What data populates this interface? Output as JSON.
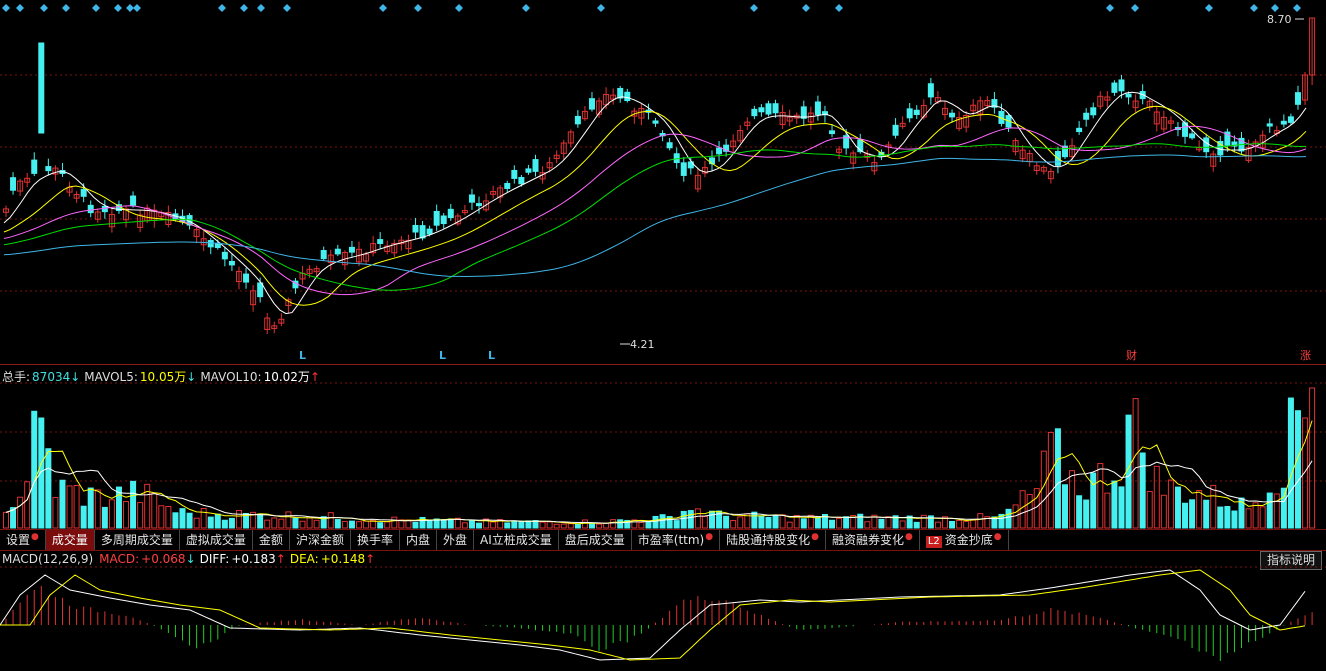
{
  "price_panel": {
    "high_label": "8.70",
    "low_label": "4.21",
    "signal_label": "L",
    "news_label": "财",
    "limit_label": "涨",
    "colors": {
      "up": "#e03232",
      "down": "#47f0f0",
      "ma5": "#ffffff",
      "ma10": "#ffff00",
      "ma20": "#ff66ff",
      "ma30": "#00dd00",
      "ma60": "#3fb6e8",
      "grid": "#7a1414",
      "marker": "#3fb6e8"
    }
  },
  "volume_panel": {
    "legend": [
      {
        "label": "总手:",
        "value": "87034",
        "arrow": "↓",
        "color": "#3fe0e0",
        "arrow_color": "#3fe0e0"
      },
      {
        "label": "MAVOL5:",
        "value": "10.05万",
        "arrow": "↓",
        "color": "#ffff00",
        "arrow_color": "#3fe0e0"
      },
      {
        "label": "MAVOL10:",
        "value": "10.02万",
        "arrow": "↑",
        "color": "#ffffff",
        "arrow_color": "#ff3333"
      }
    ]
  },
  "tabs": [
    {
      "label": "设置",
      "dot": true,
      "active": false
    },
    {
      "label": "成交量",
      "dot": false,
      "active": true
    },
    {
      "label": "多周期成交量",
      "dot": false,
      "active": false
    },
    {
      "label": "虚拟成交量",
      "dot": false,
      "active": false
    },
    {
      "label": "金额",
      "dot": false,
      "active": false
    },
    {
      "label": "沪深金额",
      "dot": false,
      "active": false
    },
    {
      "label": "换手率",
      "dot": false,
      "active": false
    },
    {
      "label": "内盘",
      "dot": false,
      "active": false
    },
    {
      "label": "外盘",
      "dot": false,
      "active": false
    },
    {
      "label": "AI立桩成交量",
      "dot": false,
      "active": false
    },
    {
      "label": "盘后成交量",
      "dot": false,
      "active": false
    },
    {
      "label": "市盈率(ttm)",
      "dot": true,
      "active": false
    },
    {
      "label": "陆股通持股变化",
      "dot": true,
      "active": false
    },
    {
      "label": "融资融券变化",
      "dot": true,
      "active": false
    },
    {
      "label": "资金抄底",
      "dot": true,
      "active": false,
      "badge": "L2"
    }
  ],
  "macd_panel": {
    "legend": [
      {
        "label": "MACD(12,26,9)",
        "value": "",
        "arrow": "",
        "color": "#dddddd",
        "arrow_color": "#dddddd"
      },
      {
        "label": "MACD:",
        "value": "+0.068",
        "arrow": "↓",
        "color": "#ff4040",
        "arrow_color": "#3fe0e0"
      },
      {
        "label": "DIFF:",
        "value": "+0.183",
        "arrow": "↑",
        "color": "#ffffff",
        "arrow_color": "#ff3333"
      },
      {
        "label": "DEA:",
        "value": "+0.148",
        "arrow": "↑",
        "color": "#ffff00",
        "arrow_color": "#ff3333"
      }
    ],
    "help_button": "指标说明"
  }
}
